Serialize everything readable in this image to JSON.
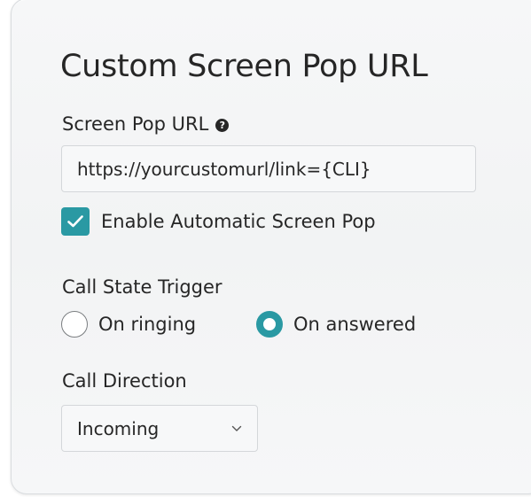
{
  "panel": {
    "title": "Custom Screen Pop URL"
  },
  "screen_pop_url": {
    "label": "Screen Pop URL",
    "help_icon": "question-icon",
    "value": "https://yourcustomurl/link={CLI}"
  },
  "auto_screen_pop": {
    "label": "Enable Automatic Screen Pop",
    "checked": true
  },
  "call_state_trigger": {
    "label": "Call State Trigger",
    "options": [
      {
        "label": "On ringing",
        "selected": false
      },
      {
        "label": "On answered",
        "selected": true
      }
    ]
  },
  "call_direction": {
    "label": "Call Direction",
    "selected": "Incoming"
  },
  "colors": {
    "accent": "#2a99a3",
    "text": "#262626",
    "panel_bg": "#f4f5f6",
    "border": "#d4d7da"
  }
}
